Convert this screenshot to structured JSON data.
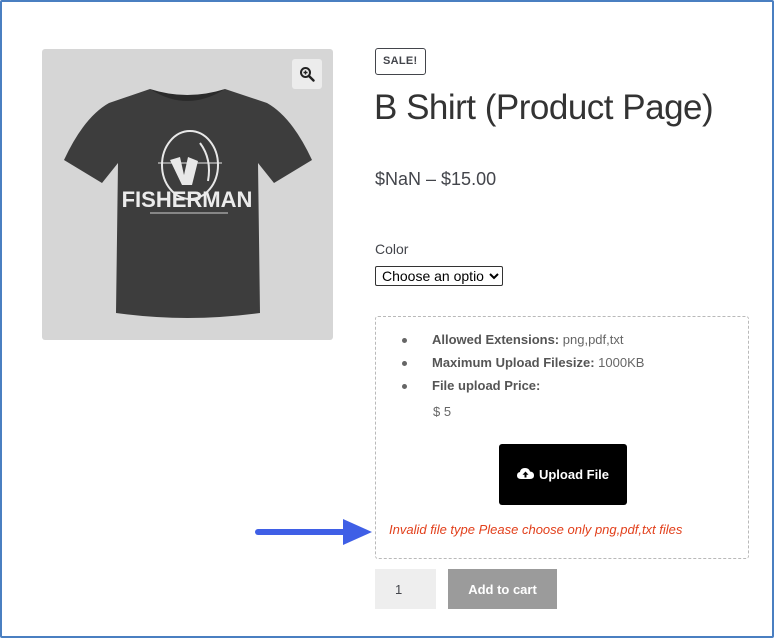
{
  "product": {
    "badge": "SALE!",
    "title": "B Shirt (Product Page)",
    "price": "$NaN – $15.00",
    "image_text": "FISHERMAN"
  },
  "variation": {
    "label": "Color",
    "selected": "Choose an option"
  },
  "upload": {
    "extensions_label": "Allowed Extensions:",
    "extensions_value": "png,pdf,txt",
    "max_size_label": "Maximum Upload Filesize:",
    "max_size_value": "1000KB",
    "price_label": "File upload Price:",
    "price_value": "$ 5",
    "button_label": "Upload File",
    "error": "Invalid file type Please choose only png,pdf,txt files"
  },
  "cart": {
    "quantity": "1",
    "button_label": "Add to cart"
  },
  "colors": {
    "frame": "#4a7fc1",
    "error": "#e2401c",
    "arrow": "#3f5fe6",
    "upload_button": "#000000",
    "cart_button": "#9b9b9b"
  },
  "icons": {
    "zoom": "magnifier-plus-icon",
    "upload": "cloud-upload-icon",
    "annotation": "arrow-right-icon"
  }
}
